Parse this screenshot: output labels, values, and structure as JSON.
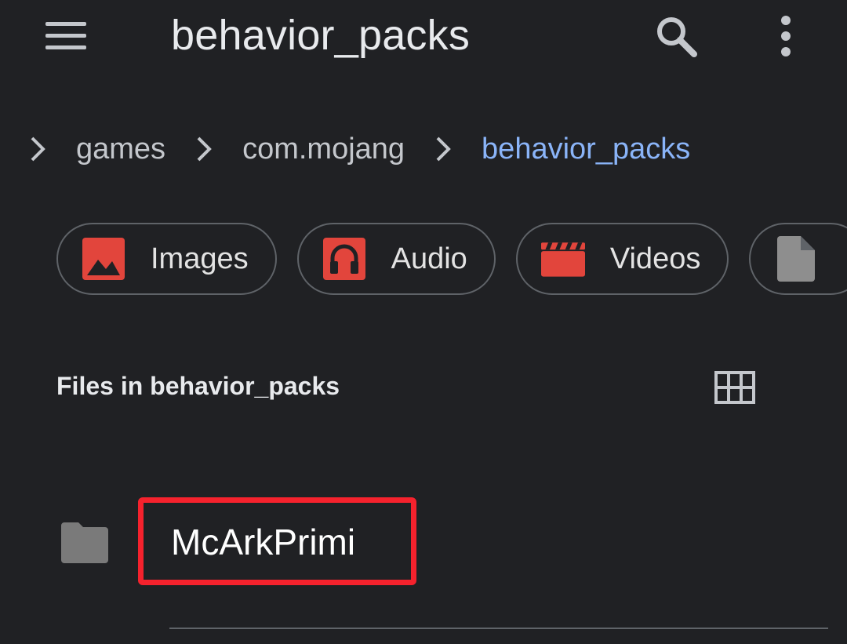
{
  "appbar": {
    "title": "behavior_packs",
    "menu_icon": "hamburger-menu-icon",
    "search_icon": "search-icon",
    "more_icon": "more-vert-icon"
  },
  "breadcrumb": {
    "truncated_first": "s",
    "items": [
      "games",
      "com.mojang",
      "behavior_packs"
    ],
    "active_color": "#8ab4f8"
  },
  "chips": [
    {
      "label": "Images",
      "icon": "image-icon",
      "color": "#e2453c"
    },
    {
      "label": "Audio",
      "icon": "headphones-icon",
      "color": "#e2453c"
    },
    {
      "label": "Videos",
      "icon": "clapperboard-icon",
      "color": "#e2453c"
    },
    {
      "label": "",
      "icon": "document-icon",
      "color": "#8e8e8e"
    }
  ],
  "section": {
    "title": "Files in behavior_packs",
    "view_toggle_icon": "grid-view-icon"
  },
  "files": [
    {
      "name": "McArkPrimi",
      "type": "folder",
      "icon": "folder-icon",
      "highlighted": true,
      "highlight_color": "#f5222d"
    }
  ]
}
